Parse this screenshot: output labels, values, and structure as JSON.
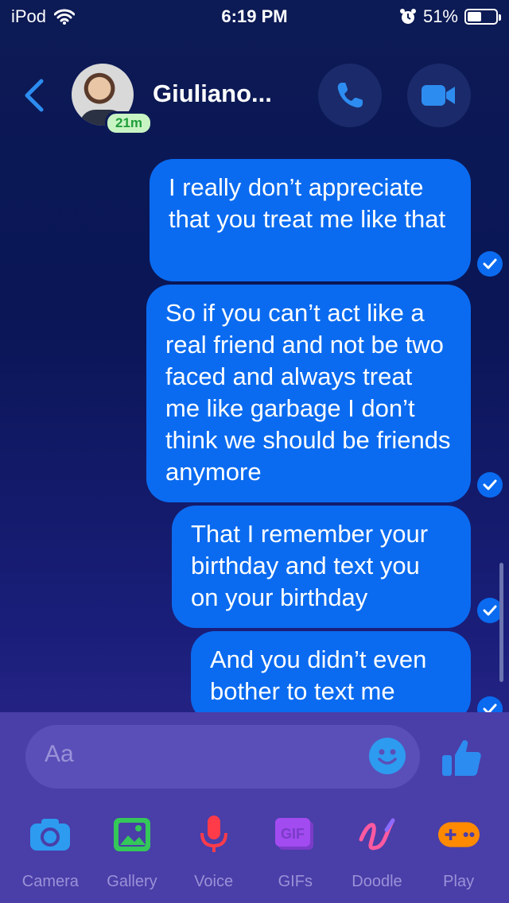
{
  "status_bar": {
    "carrier": "iPod",
    "time": "6:19 PM",
    "battery": "51%",
    "battery_level": 0.51
  },
  "header": {
    "contact_name": "Giuliano...",
    "active_badge": "21m"
  },
  "messages": [
    {
      "text": "I really don’t appreciate that you treat me like that"
    },
    {
      "text": "So if you can’t act like a real friend and not be two faced and always treat me like garbage I don’t think we should be friends anymore"
    },
    {
      "text": "That I remember your birthday and text you on your birthday"
    },
    {
      "text": "And you didn’t even bother to text me"
    }
  ],
  "composer": {
    "placeholder": "Aa",
    "tools": [
      {
        "label": "Camera",
        "icon": "camera-icon",
        "color": "#2d9bf0"
      },
      {
        "label": "Gallery",
        "icon": "gallery-icon",
        "color": "#34c759"
      },
      {
        "label": "Voice",
        "icon": "microphone-icon",
        "color": "#ff3b4a"
      },
      {
        "label": "GIFs",
        "icon": "gif-icon",
        "color": "#a24bf0"
      },
      {
        "label": "Doodle",
        "icon": "doodle-icon",
        "color": "#ff5aa0"
      },
      {
        "label": "Play",
        "icon": "gamepad-icon",
        "color": "#ff8a00"
      }
    ]
  },
  "colors": {
    "bubble": "#0a6bf0",
    "accent": "#2d8cf0"
  }
}
